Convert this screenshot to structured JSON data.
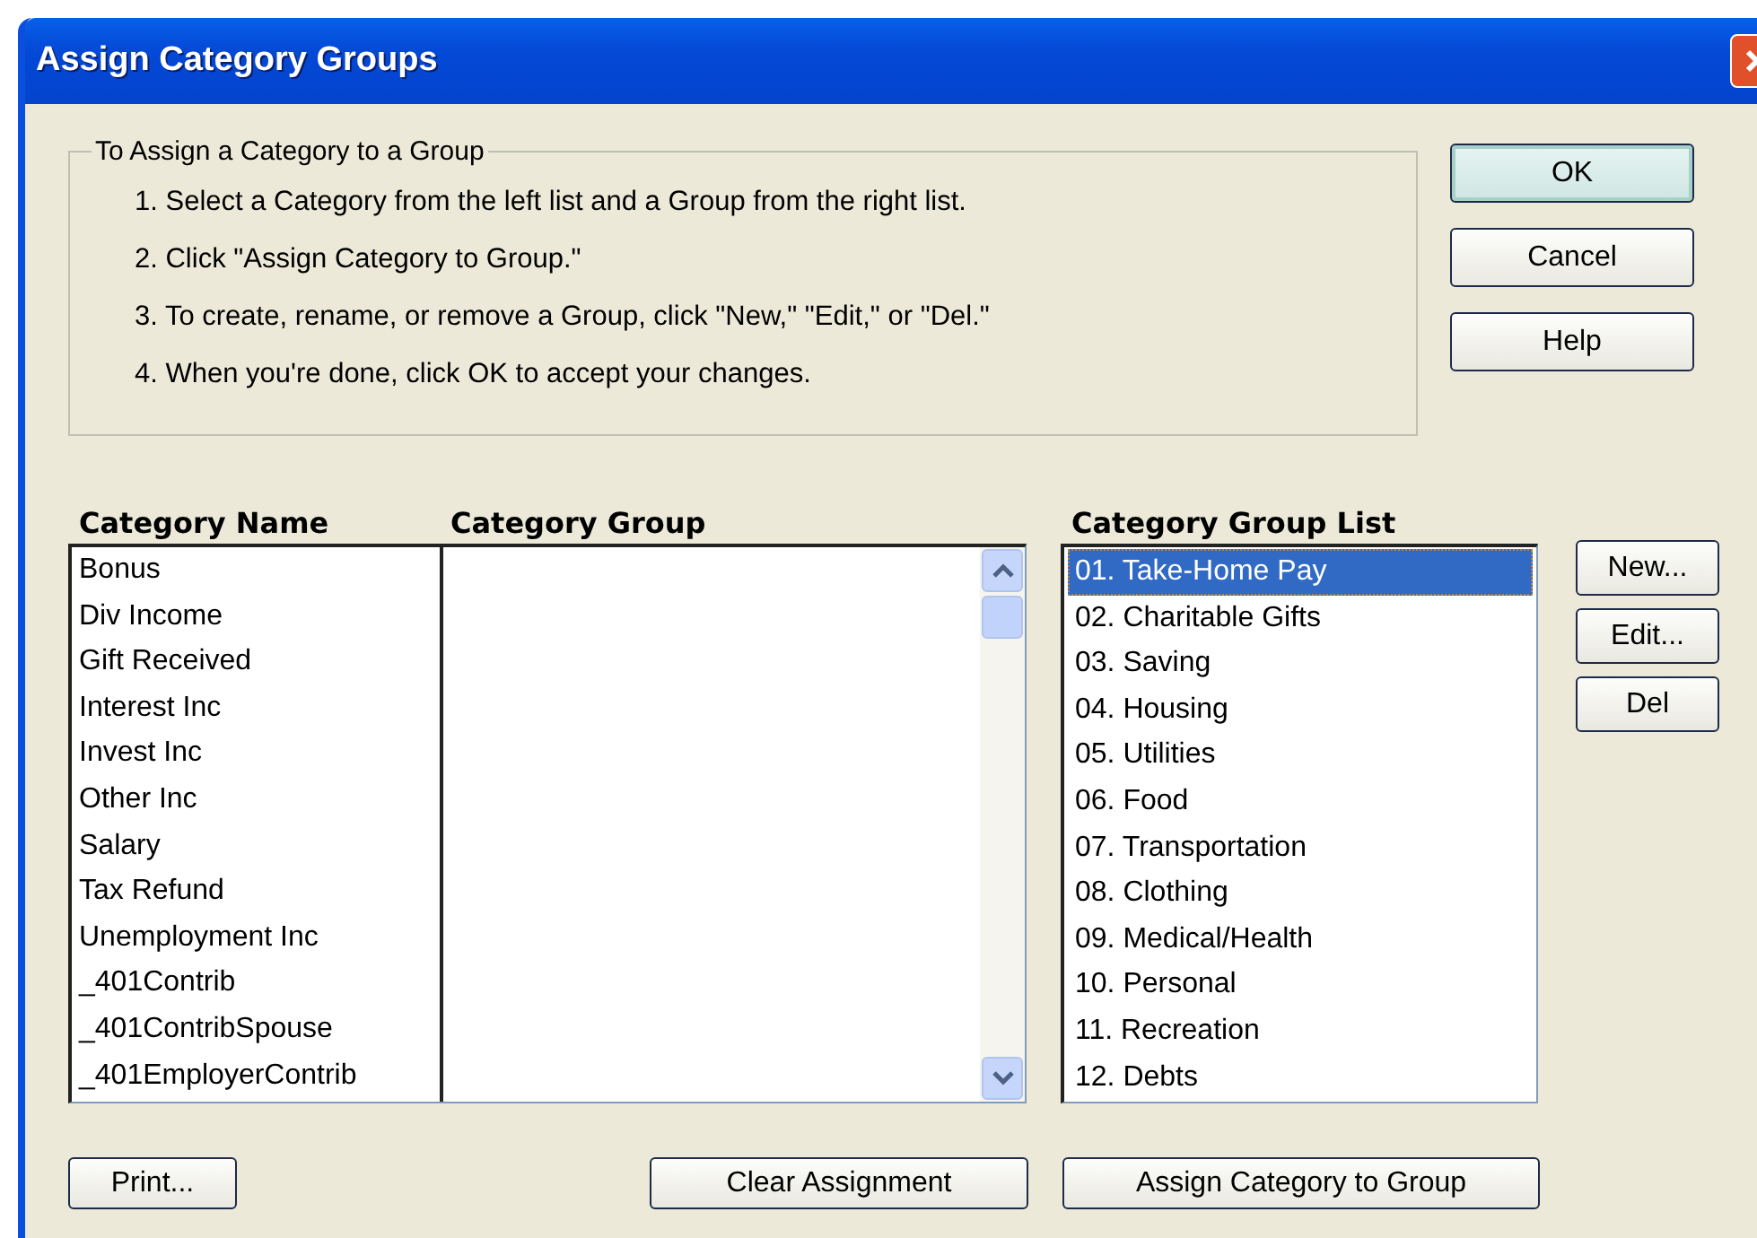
{
  "window": {
    "title": "Assign Category Groups"
  },
  "instructions": {
    "legend": "To Assign a Category to a Group",
    "steps": [
      "1. Select a Category from the left list and a Group from the right list.",
      "2. Click \"Assign Category to Group.\"",
      "3. To create, rename, or remove a Group, click \"New,\" \"Edit,\" or \"Del.\"",
      "4. When you're done, click OK to accept your changes."
    ]
  },
  "dialog_buttons": [
    {
      "label": "OK",
      "default": true
    },
    {
      "label": "Cancel",
      "default": false
    },
    {
      "label": "Help",
      "default": false
    }
  ],
  "category_table": {
    "columns": [
      "Category Name",
      "Category Group"
    ],
    "rows": [
      {
        "name": "Bonus"
      },
      {
        "name": "Div Income"
      },
      {
        "name": "Gift Received"
      },
      {
        "name": "Interest Inc"
      },
      {
        "name": "Invest Inc"
      },
      {
        "name": "Other Inc"
      },
      {
        "name": "Salary"
      },
      {
        "name": "Tax Refund"
      },
      {
        "name": "Unemployment Inc"
      },
      {
        "name": "_401Contrib"
      },
      {
        "name": "_401ContribSpouse"
      },
      {
        "name": "_401EmployerContrib"
      }
    ]
  },
  "group_list": {
    "heading": "Category Group List",
    "items": [
      {
        "label": "01. Take-Home Pay",
        "selected": true
      },
      {
        "label": "02. Charitable Gifts",
        "selected": false
      },
      {
        "label": "03. Saving",
        "selected": false
      },
      {
        "label": "04. Housing",
        "selected": false
      },
      {
        "label": "05. Utilities",
        "selected": false
      },
      {
        "label": "06. Food",
        "selected": false
      },
      {
        "label": "07. Transportation",
        "selected": false
      },
      {
        "label": "08. Clothing",
        "selected": false
      },
      {
        "label": "09. Medical/Health",
        "selected": false
      },
      {
        "label": "10. Personal",
        "selected": false
      },
      {
        "label": "11. Recreation",
        "selected": false
      },
      {
        "label": "12. Debts",
        "selected": false
      }
    ]
  },
  "group_buttons": [
    "New...",
    "Edit...",
    "Del"
  ],
  "bottom_buttons": [
    "Print...",
    "Clear Assignment",
    "Assign Category to Group"
  ]
}
